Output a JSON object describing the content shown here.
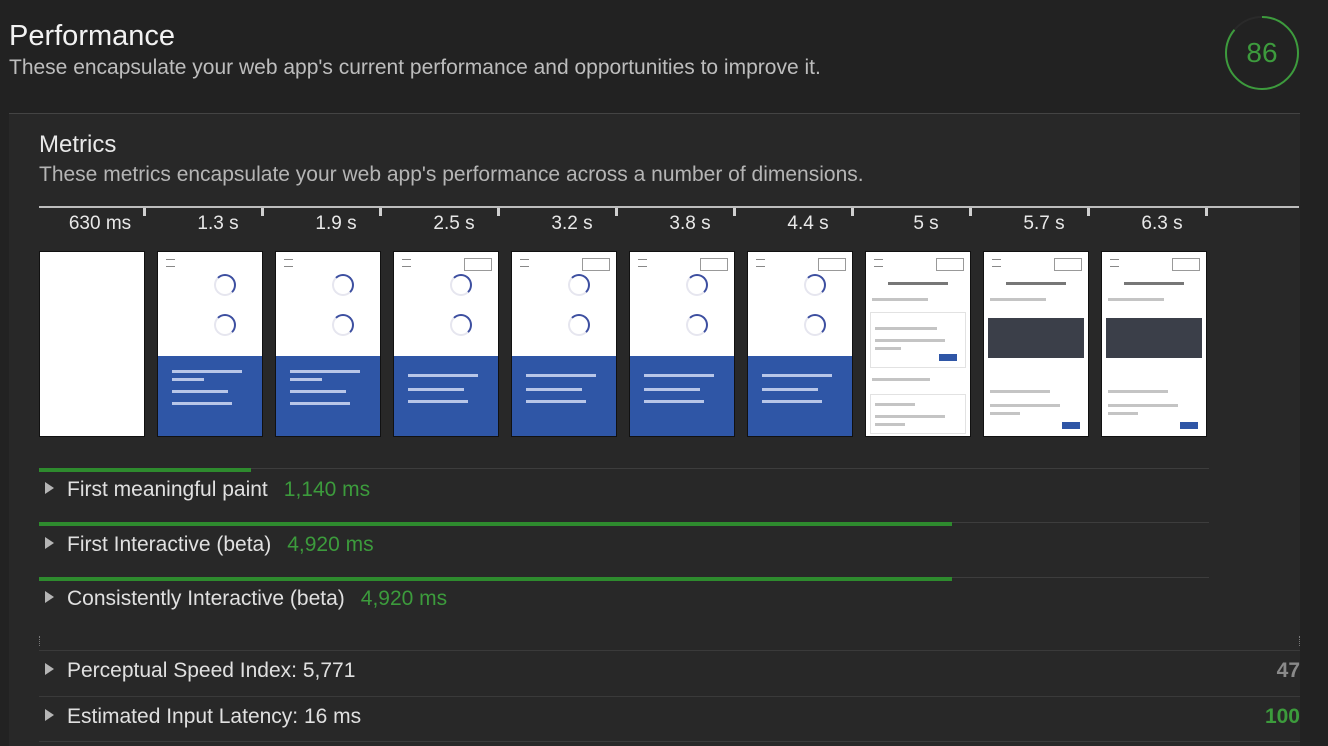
{
  "header": {
    "title": "Performance",
    "description": "These encapsulate your web app's current performance and opportunities to improve it.",
    "score": "86",
    "score_fraction": 0.86,
    "score_color": "#3d9b3d"
  },
  "metrics_section": {
    "title": "Metrics",
    "description": "These metrics encapsulate your web app's performance across a number of dimensions."
  },
  "filmstrip": {
    "timestamps": [
      "630 ms",
      "1.3 s",
      "1.9 s",
      "2.5 s",
      "3.2 s",
      "3.8 s",
      "4.4 s",
      "5 s",
      "5.7 s",
      "6.3 s"
    ]
  },
  "metrics": [
    {
      "label": "First meaningful paint",
      "value": "1,140 ms",
      "progress_ms": 1140
    },
    {
      "label": "First Interactive (beta)",
      "value": "4,920 ms",
      "progress_ms": 4920
    },
    {
      "label": "Consistently Interactive (beta)",
      "value": "4,920 ms",
      "progress_ms": 4920
    }
  ],
  "scored_metrics": [
    {
      "label": "Perceptual Speed Index: 5,771",
      "score": "47",
      "color": "#8a8a8a"
    },
    {
      "label": "Estimated Input Latency: 16 ms",
      "score": "100",
      "color": "#3c9b3c"
    }
  ],
  "colors": {
    "background": "#222222",
    "panel": "#282828",
    "accent_green": "#2e8b2e",
    "footer_blue": "#2f56a6"
  }
}
